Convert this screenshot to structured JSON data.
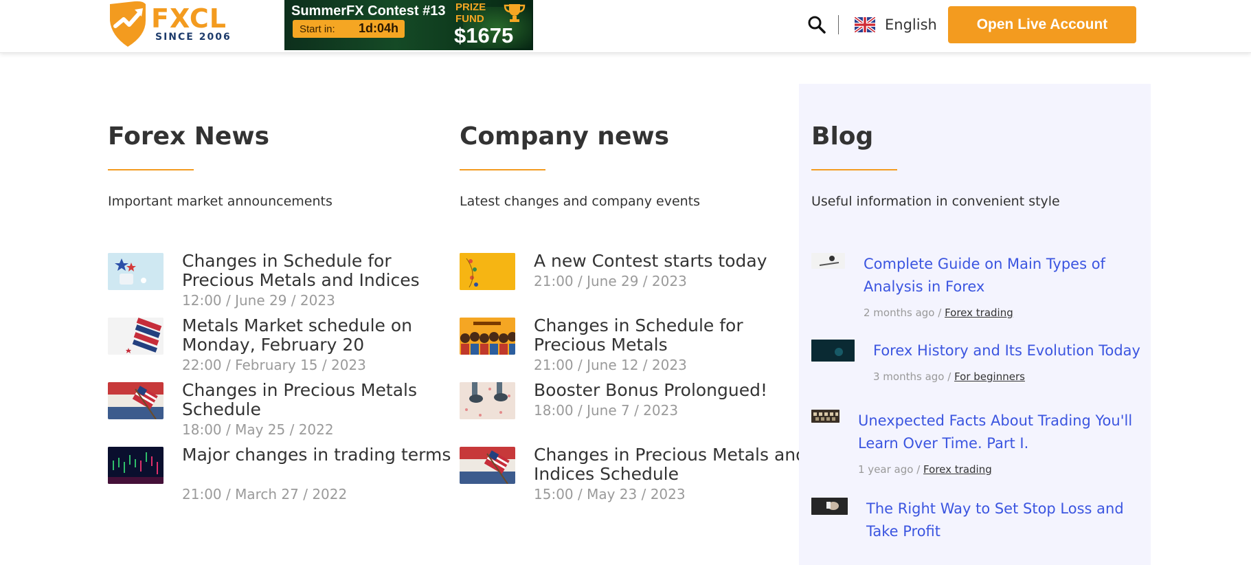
{
  "header": {
    "logo": {
      "name": "FXCL",
      "since": "SINCE 2006"
    },
    "banner": {
      "title": "SummerFX Contest #13",
      "start_label": "Start in:",
      "start_value": "1d:04h",
      "prize_line1": "PRIZE",
      "prize_line2": "FUND",
      "amount": "$1675"
    },
    "language": "English",
    "cta_label": "Open Live Account",
    "colors": {
      "accent": "#f39b1f",
      "link": "#3b55e0",
      "blog_bg": "#f4f4fe"
    }
  },
  "forex_news": {
    "title": "Forex News",
    "subtitle": "Important market announcements",
    "items": [
      {
        "title": "Changes in Schedule for Precious Metals and Indices",
        "date": "12:00 / June 29 / 2023",
        "thumb": "stars-thumb"
      },
      {
        "title": "Metals Market schedule on Monday, February 20",
        "date": "22:00 / February 15 / 2023",
        "thumb": "us-flags-thumb"
      },
      {
        "title": "Changes in Precious Metals Schedule",
        "date": "18:00 / May 25 / 2022",
        "thumb": "us-flag-thumb"
      },
      {
        "title": "Major changes in trading terms",
        "date": "21:00 / March 27 / 2022",
        "thumb": "chart-thumb"
      }
    ]
  },
  "company_news": {
    "title": "Company news",
    "subtitle": "Latest changes and company events",
    "items": [
      {
        "title": "A new Contest starts today",
        "date": "21:00 / June 29 / 2023",
        "thumb": "summer-thumb"
      },
      {
        "title": "Changes in Schedule for Precious Metals",
        "date": "21:00 / June 12 / 2023",
        "thumb": "people-thumb"
      },
      {
        "title": "Booster Bonus Prolongued!",
        "date": "18:00 / June 7 / 2023",
        "thumb": "shoes-thumb"
      },
      {
        "title": "Changes in Precious Metals and Indices Schedule",
        "date": "15:00 / May 23 / 2023",
        "thumb": "us-flag-thumb"
      }
    ]
  },
  "blog": {
    "title": "Blog",
    "subtitle": "Useful information in convenient style",
    "items": [
      {
        "title": "Complete Guide on Main Types of Analysis in Forex",
        "ago": "2 months ago /",
        "category": "Forex trading"
      },
      {
        "title": "Forex History and Its Evolution Today",
        "ago": "3 months ago /",
        "category": "For beginners"
      },
      {
        "title": "Unexpected Facts About Trading You'll Learn Over Time. Part I.",
        "ago": "1 year ago /",
        "category": "Forex trading"
      },
      {
        "title": "The Right Way to Set Stop Loss and Take Profit",
        "ago": "",
        "category": ""
      }
    ]
  }
}
